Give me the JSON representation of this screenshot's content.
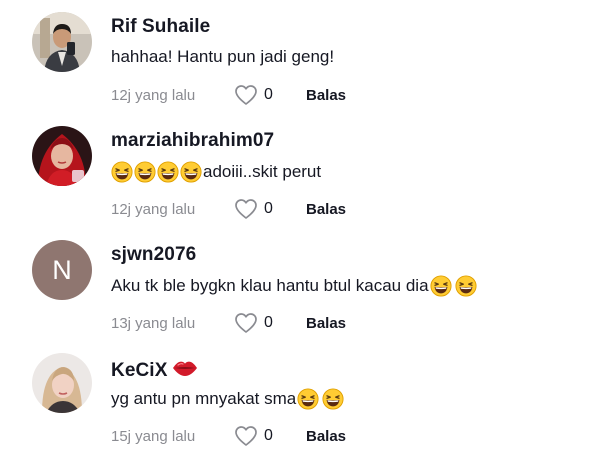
{
  "comments": [
    {
      "username": "Rif Suhaile",
      "text": "hahhaa! Hantu pun jadi geng!",
      "time": "12j yang lalu",
      "likes": "0",
      "reply_label": "Balas"
    },
    {
      "username": "marziahibrahim07",
      "text": "adoiii..skit perut",
      "emoji_before": [
        "grinning-squint-emoji",
        "grinning-squint-emoji",
        "grinning-squint-emoji",
        "grinning-squint-emoji"
      ],
      "time": "12j yang lalu",
      "likes": "0",
      "reply_label": "Balas"
    },
    {
      "username": "sjwn2076",
      "avatar_letter": "N",
      "text": "Aku tk ble bygkn klau hantu btul kacau dia",
      "emoji_after": [
        "grinning-squint-emoji",
        "grinning-squint-emoji"
      ],
      "time": "13j yang lalu",
      "likes": "0",
      "reply_label": "Balas"
    },
    {
      "username": "KeCiX",
      "badge": "lips-emoji",
      "text": "yg antu pn mnyakat sma",
      "emoji_after": [
        "grinning-squint-emoji",
        "grinning-squint-emoji"
      ],
      "time": "15j yang lalu",
      "likes": "0",
      "reply_label": "Balas"
    }
  ],
  "colors": {
    "text": "#161823",
    "meta": "#8a8b91",
    "letter_avatar_bg": "#8f7670"
  }
}
